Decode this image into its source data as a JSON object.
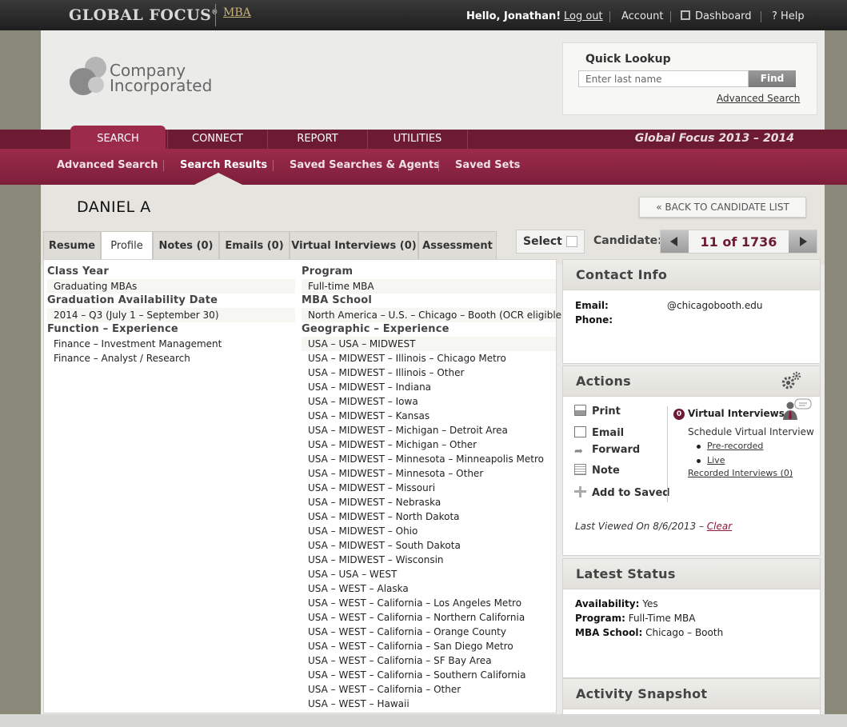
{
  "topbar": {
    "brand": "GLOBAL FOCUS",
    "brand_mark": "®",
    "brand_sub": "MBA",
    "hello": "Hello, Jonathan!",
    "logout": "Log out",
    "account": "Account",
    "dashboard": "Dashboard",
    "help": "? Help"
  },
  "logo": {
    "line1": "Company",
    "line2": "Incorporated"
  },
  "quick_lookup": {
    "title": "Quick Lookup",
    "placeholder": "Enter last name",
    "find": "Find",
    "advanced": "Advanced Search"
  },
  "main_nav": {
    "items": [
      "SEARCH",
      "CONNECT",
      "REPORT",
      "UTILITIES"
    ],
    "season": "Global Focus 2013 – 2014"
  },
  "sub_nav": {
    "items": [
      "Advanced Search",
      "Search Results",
      "Saved Searches & Agents",
      "Saved Sets"
    ]
  },
  "candidate": {
    "name": "DANIEL A",
    "back": "« BACK TO CANDIDATE LIST",
    "select": "Select",
    "candidate_label": "Candidate:",
    "position": "11 of 1736"
  },
  "tabs": [
    "Resume",
    "Profile",
    "Notes (0)",
    "Emails (0)",
    "Virtual Interviews (0)",
    "Assessment"
  ],
  "profile": {
    "class_year_label": "Class Year",
    "class_year": "Graduating MBAs",
    "grad_label": "Graduation Availability Date",
    "grad": "2014 – Q3 (July 1 – September 30)",
    "function_label": "Function – Experience",
    "functions": [
      "Finance – Investment Management",
      "Finance – Analyst / Research"
    ],
    "program_label": "Program",
    "program": "Full-time MBA",
    "school_label": "MBA School",
    "school": "North America – U.S. – Chicago – Booth (OCR eligible)",
    "geo_label": "Geographic – Experience",
    "geo": [
      "USA – USA – MIDWEST",
      "USA – MIDWEST – Illinois – Chicago Metro",
      "USA – MIDWEST – Illinois – Other",
      "USA – MIDWEST – Indiana",
      "USA – MIDWEST – Iowa",
      "USA – MIDWEST – Kansas",
      "USA – MIDWEST – Michigan – Detroit Area",
      "USA – MIDWEST – Michigan – Other",
      "USA – MIDWEST – Minnesota – Minneapolis Metro",
      "USA – MIDWEST – Minnesota – Other",
      "USA – MIDWEST – Missouri",
      "USA – MIDWEST – Nebraska",
      "USA – MIDWEST – North Dakota",
      "USA – MIDWEST – Ohio",
      "USA – MIDWEST – South Dakota",
      "USA – MIDWEST – Wisconsin",
      "USA – USA – WEST",
      "USA – WEST – Alaska",
      "USA – WEST – California – Los Angeles Metro",
      "USA – WEST – California – Northern California",
      "USA – WEST – California – Orange County",
      "USA – WEST – California – San Diego Metro",
      "USA – WEST – California – SF Bay Area",
      "USA – WEST – California – Southern California",
      "USA – WEST – California – Other",
      "USA – WEST – Hawaii"
    ]
  },
  "contact": {
    "title": "Contact Info",
    "email_label": "Email:",
    "email": "@chicagobooth.edu",
    "phone_label": "Phone:"
  },
  "actions": {
    "title": "Actions",
    "print": "Print",
    "email": "Email",
    "forward": "Forward",
    "note": "Note",
    "add_saved": "Add to Saved",
    "vi_count": "0",
    "vi_title": "Virtual Interviews",
    "schedule": "Schedule Virtual Interview",
    "prerecorded": "Pre-recorded",
    "live": "Live",
    "recorded": "Recorded Interviews (0)",
    "last_viewed": "Last Viewed On 8/6/2013 – ",
    "clear": "Clear"
  },
  "status": {
    "title": "Latest Status",
    "availability_label": "Availability:",
    "availability": "Yes",
    "program_label": "Program:",
    "program": "Full-Time MBA",
    "school_label": "MBA School:",
    "school": "Chicago – Booth"
  },
  "activity": {
    "title": "Activity Snapshot"
  }
}
